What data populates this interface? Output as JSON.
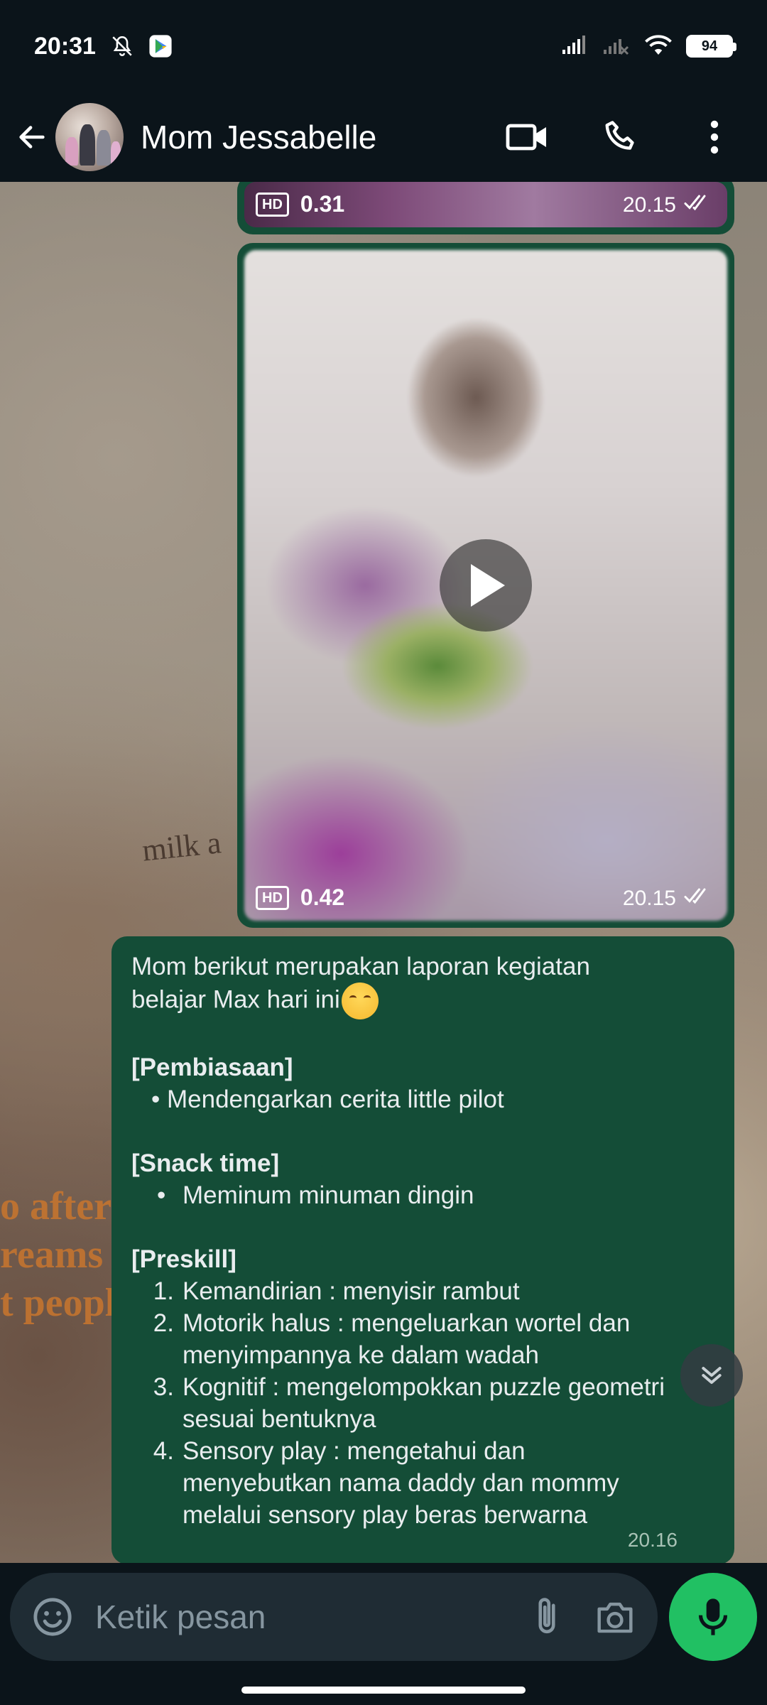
{
  "status_bar": {
    "time": "20:31",
    "battery": "94"
  },
  "header": {
    "contact_name": "Mom Jessabelle",
    "icons": [
      "back-arrow-icon",
      "video-call-icon",
      "voice-call-icon",
      "more-options-icon"
    ]
  },
  "messages": [
    {
      "type": "video",
      "hd_label": "HD",
      "duration": "0.31",
      "time": "20.15"
    },
    {
      "type": "video",
      "hd_label": "HD",
      "duration": "0.42",
      "time": "20.15"
    },
    {
      "type": "text",
      "intro_line1": "Mom berikut merupakan laporan kegiatan",
      "intro_line2": "belajar Max hari ini",
      "section1_title": "[Pembiasaan]",
      "section1_item": "• Mendengarkan cerita little pilot",
      "section2_title": "[Snack time]",
      "section2_bullet": "•",
      "section2_item": "Meminum minuman dingin",
      "section3_title": "[Preskill]",
      "preskill_items": [
        {
          "num": "1.",
          "line1": "Kemandirian : menyisir rambut",
          "line2": "",
          "line3": ""
        },
        {
          "num": "2.",
          "line1": "Motorik halus : mengeluarkan wortel dan",
          "line2": "menyimpannya ke dalam wadah",
          "line3": ""
        },
        {
          "num": "3.",
          "line1": "Kognitif : mengelompokkan puzzle geometri",
          "line2": "sesuai bentuknya",
          "line3": ""
        },
        {
          "num": "4.",
          "line1": "Sensory play : mengetahui dan",
          "line2": "menyebutkan nama daddy dan mommy",
          "line3": "melalui sensory play beras berwarna"
        }
      ],
      "time": "20.16"
    }
  ],
  "wallpaper_text": {
    "milk": "milk a",
    "line1": "o after",
    "line2": "reams",
    "line3": "t peopl"
  },
  "input": {
    "placeholder": "Ketik pesan"
  },
  "colors": {
    "bubble": "#144d37",
    "accent": "#21c063",
    "background": "#0b141a",
    "input_bar": "#1f2c34"
  }
}
